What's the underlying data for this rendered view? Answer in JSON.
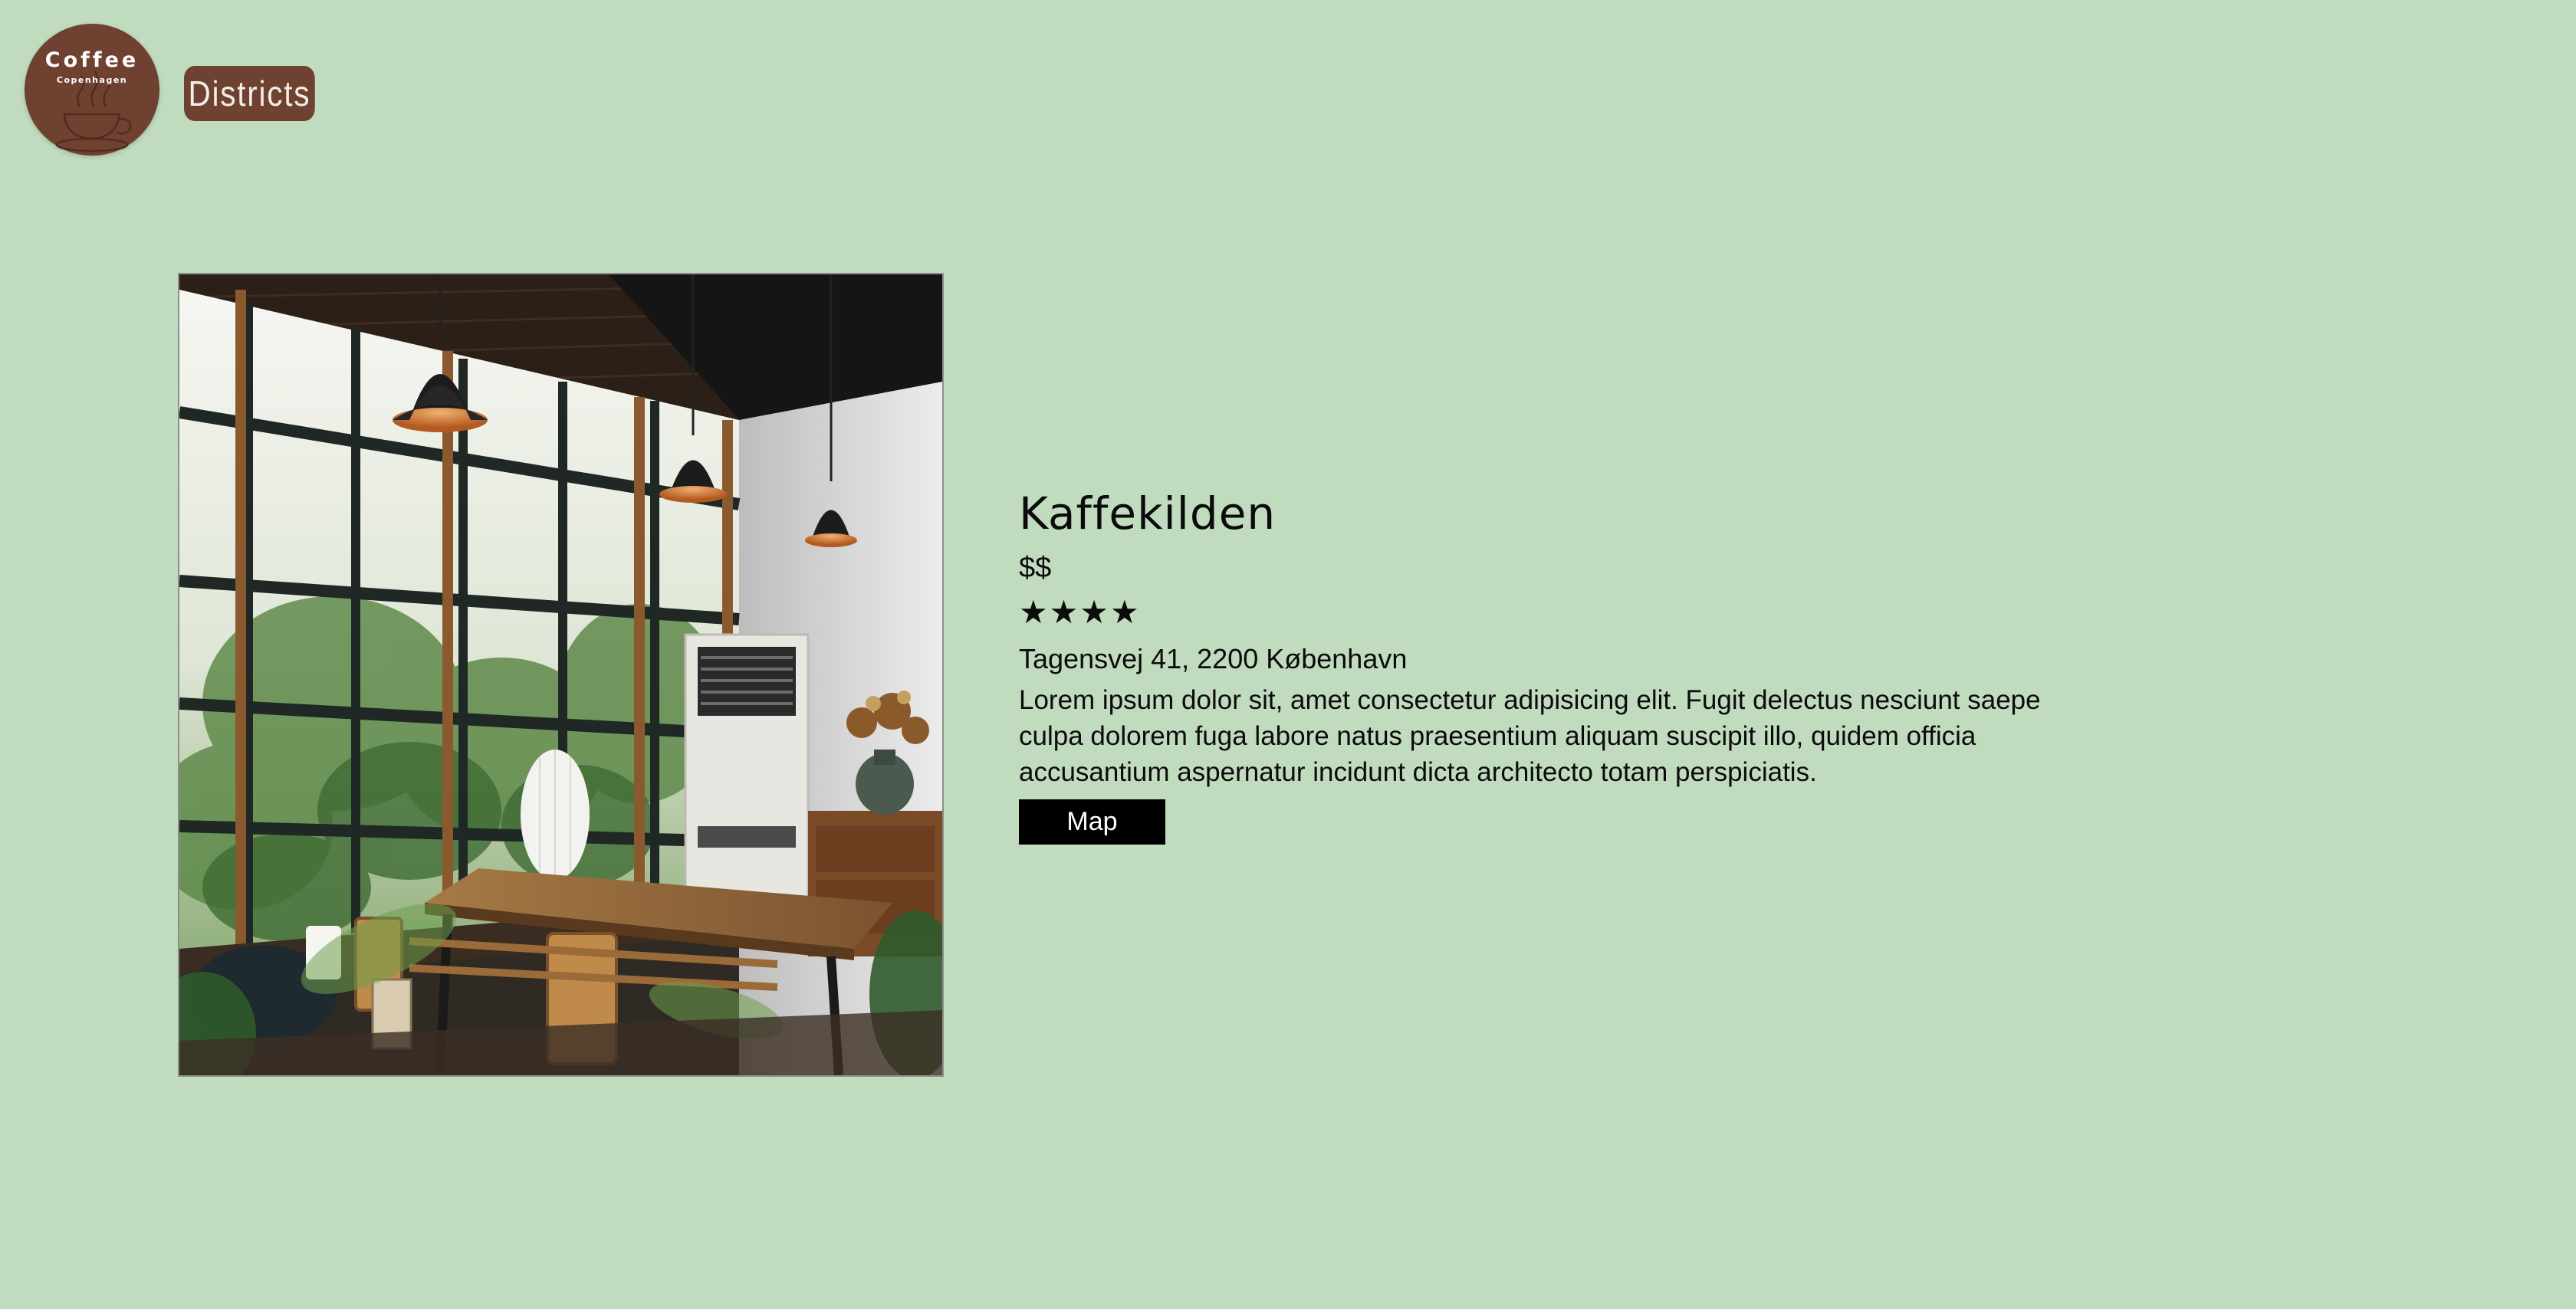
{
  "header": {
    "logo": {
      "title": "Coffee",
      "subtitle": "Copenhagen",
      "icon": "coffee-cup-icon"
    },
    "nav_button": "Districts"
  },
  "cafe": {
    "name": "Kaffekilden",
    "price": "$$",
    "rating_stars": "★★★★",
    "rating_value": 4,
    "address": "Tagensvej 41, 2200 København",
    "description": "Lorem ipsum dolor sit, amet consectetur adipisicing elit. Fugit delectus nesciunt saepe culpa dolorem fuga labore natus praesentium aliquam suscipit illo, quidem officia accusantium aspernatur incidunt dicta architecto totam perspiciatis.",
    "map_button": "Map"
  },
  "colors": {
    "background": "#c1dbbf",
    "brand_brown": "#6f4130",
    "button_black": "#000000"
  }
}
